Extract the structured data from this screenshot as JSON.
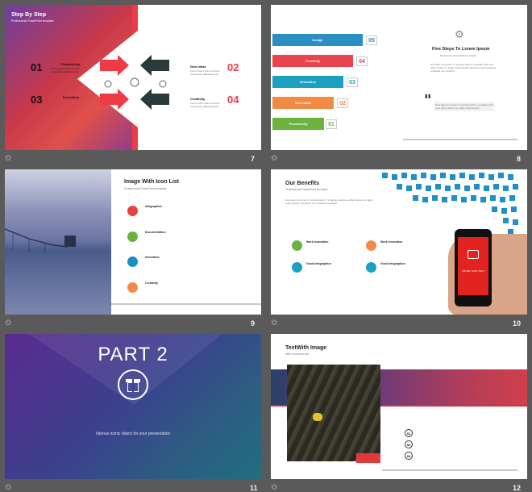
{
  "slides": [
    {
      "number": "7",
      "title": "Step By Step",
      "subtitle": "Professional   PowerPoint   template",
      "steps": [
        {
          "num": "01",
          "label": "Productivity",
          "text": "Lorem ipsum dolor sit amet, consectetur adipiscing elit."
        },
        {
          "num": "02",
          "label": "New Ideas",
          "text": "Lorem ipsum dolor sit amet, consectetur adipiscing elit."
        },
        {
          "num": "03",
          "label": "Innovation",
          "text": "Lorem ipsum dolor sit amet, consectetur adipiscing elit."
        },
        {
          "num": "04",
          "label": "Creativity",
          "text": "Lorem ipsum dolor sit amet, consectetur adipiscing elit."
        }
      ]
    },
    {
      "number": "8",
      "bars": [
        {
          "label": "Design",
          "num": "05",
          "color": "#2b8fc4"
        },
        {
          "label": "Creativity",
          "num": "04",
          "color": "#e9434d"
        },
        {
          "label": "Innovation",
          "num": "03",
          "color": "#1ba0c2"
        },
        {
          "label": "New Ideas",
          "num": "02",
          "color": "#f08a45"
        },
        {
          "label": "Productivity",
          "num": "01",
          "color": "#6bb33e"
        }
      ],
      "title": "Five Steps To Lorem Ipsum",
      "subtitle": "Professional   PowerPoint   template",
      "body": "Duis aute irure dolor in reprehenderit in voluptate velit esse cillum dolore eu fugiat nulla pariatur. Excepteur sint occaecat cupidatat non proident.",
      "quote": "Duis aute irure dolor in reprehenderit in voluptate velit esse cillum dolore eu fugiat nulla pariatur."
    },
    {
      "number": "9",
      "title": "Image With  Icon List",
      "subtitle": "Professional   PowerPoint   template",
      "items": [
        {
          "label": "Infographics",
          "color": "#e6403f"
        },
        {
          "label": "Documentation",
          "color": "#6bb33e"
        },
        {
          "label": "Innovation",
          "color": "#1b8fbf"
        },
        {
          "label": "Creativity",
          "color": "#f08a45"
        }
      ]
    },
    {
      "number": "10",
      "title": "Our Benefits",
      "subtitle": "Professional   PowerPoint   template",
      "body": "Duis aute irure dolor in reprehenderit in voluptate velit esse cillum dolore eu fugiat nulla pariatur. Excepteur sint occaecat cupidatat.",
      "benefits": [
        {
          "label": "Work Innovation",
          "color": "#6bb33e"
        },
        {
          "label": "Work Innovation",
          "color": "#f08a45"
        },
        {
          "label": "Good Infographics",
          "color": "#1ba0c2"
        },
        {
          "label": "Good Infographics",
          "color": "#1ba0c2"
        }
      ],
      "phone_text": "ENTER YOUR TEXT"
    },
    {
      "number": "11",
      "title": "PART  2",
      "subtitle": "Various iconic object for your presentation"
    },
    {
      "number": "12",
      "title": "TextWith Image",
      "subtitle": "With numbered list",
      "list": [
        "01",
        "02",
        "03"
      ]
    }
  ],
  "star_glyph": "✩",
  "footer_logo": "Logo"
}
